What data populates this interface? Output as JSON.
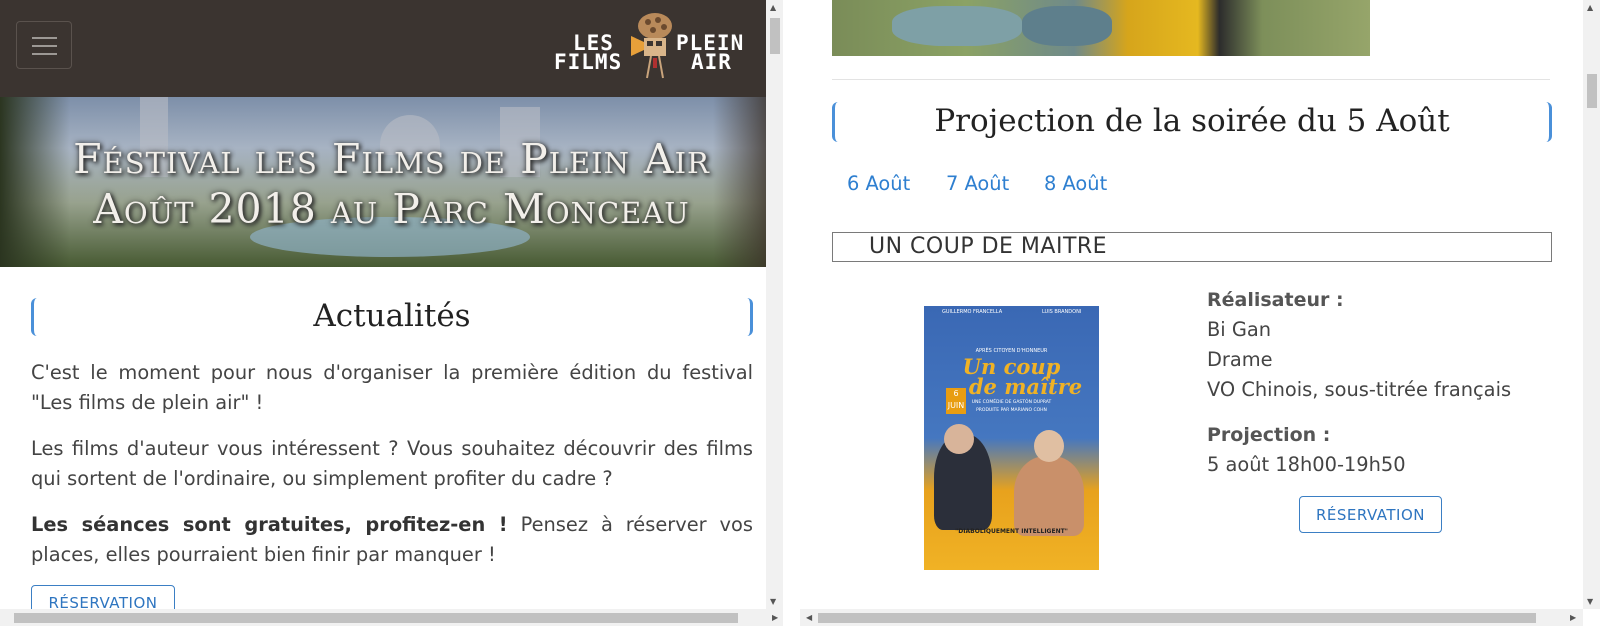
{
  "left": {
    "logo": {
      "line1a": "LES",
      "line1b": "PLEIN",
      "line2a": "FILMS",
      "line2b": "AIR"
    },
    "banner": {
      "line1": "Féstival les Films de Plein Air",
      "line2": "Août 2018 au Parc Monceau"
    },
    "section_title": "Actualités",
    "para1": "C'est le moment pour nous d'organiser la première édition du festival \"Les films de plein air\" !",
    "para2": "Les films d'auteur vous intéressent ? Vous souhaitez découvrir des films qui sortent de l'ordinaire, ou simplement profiter du cadre ?",
    "para3_bold": "Les séances sont gratuites, profitez-en !",
    "para3_rest": " Pensez à réserver vos places, elles pourraient bien finir par manquer !",
    "reservation_button": "RÉSERVATION"
  },
  "right": {
    "section_title": "Projection de la soirée du 5 Août",
    "days": [
      "6 Août",
      "7 Août",
      "8 Août"
    ],
    "film": {
      "title": "UN COUP DE MAITRE",
      "director_label": "Réalisateur :",
      "director": "Bi Gan",
      "genre": "Drame",
      "language": "VO Chinois, sous-titrée français",
      "projection_label": "Projection :",
      "projection": "5 août 18h00-19h50",
      "reservation_button": "RÉSERVATION",
      "poster": {
        "top_left": "GUILLERMO FRANCELLA",
        "top_right": "LUIS BRANDONI",
        "tagline": "APRÈS CITOYEN D'HONNEUR",
        "title_line1": "Un coup",
        "title_line2": "de maître",
        "credit1": "UNE COMÉDIE DE GASTÓN DUPRAT",
        "credit2": "PRODUITE PAR MARIANO COHN",
        "badge": "6 JUIN",
        "quote": "\"DIABOLIQUEMENT INTELLIGENT\""
      }
    }
  },
  "colors": {
    "nav_bg": "#3b3430",
    "accent": "#2e7fd0",
    "title_border": "#4a90d9"
  }
}
